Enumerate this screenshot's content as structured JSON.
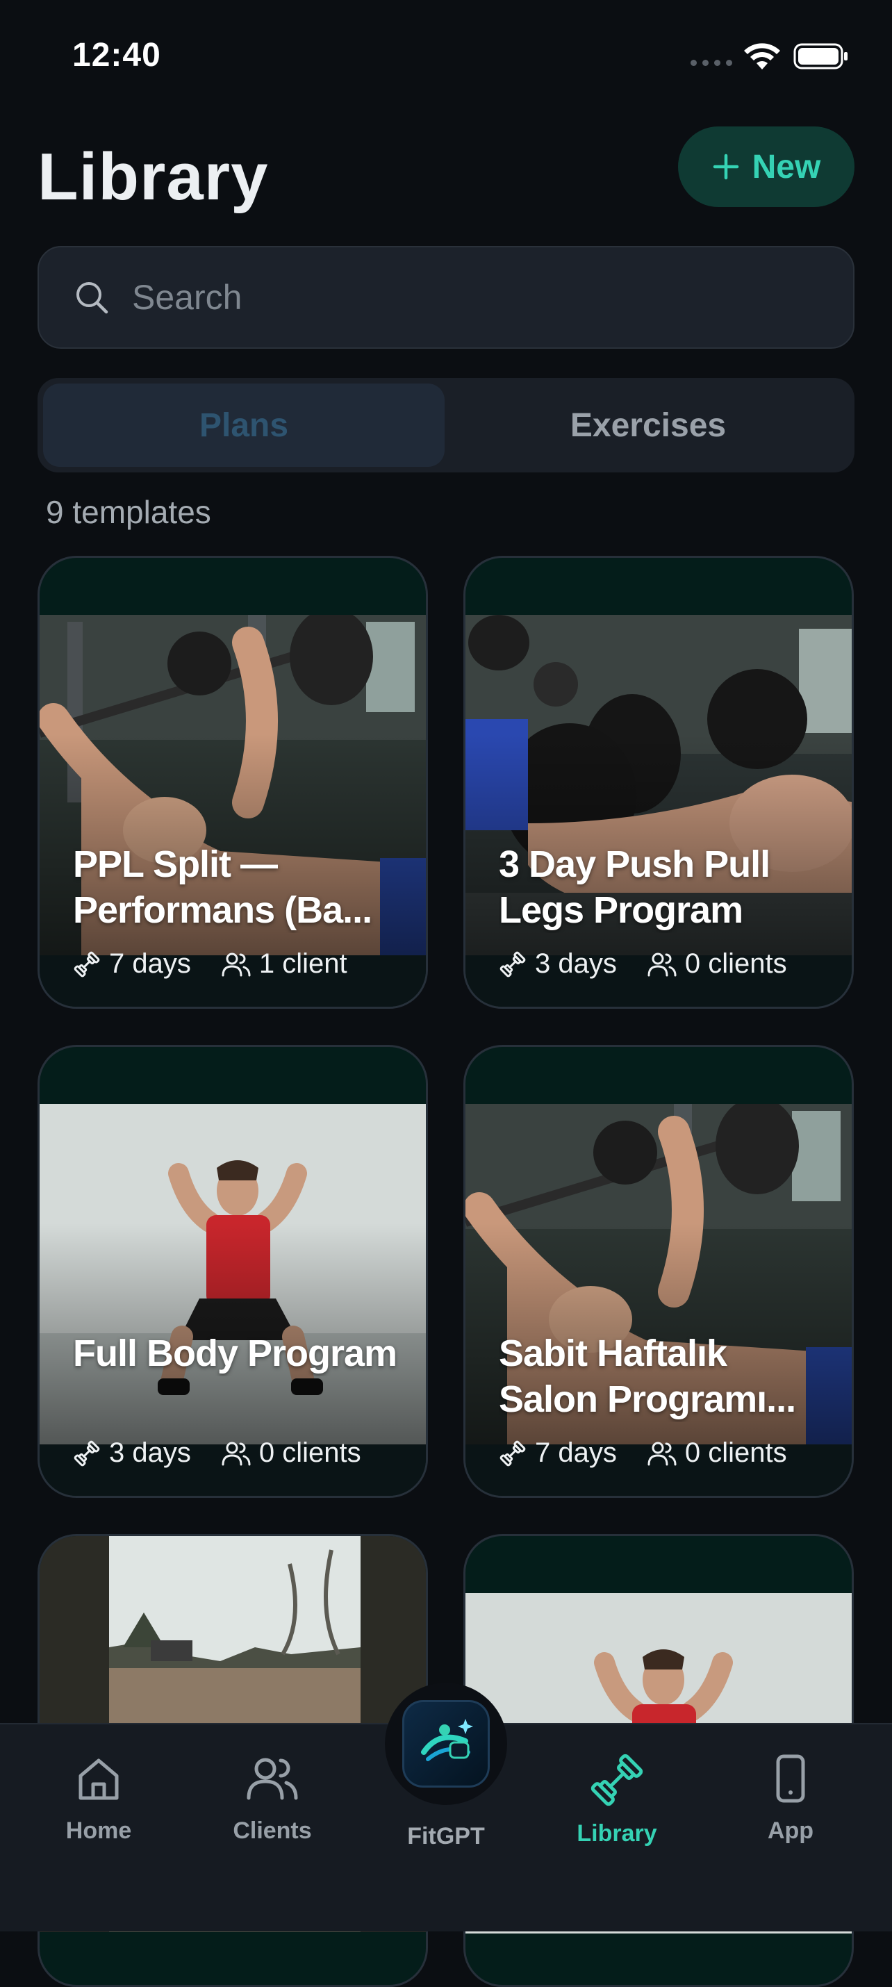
{
  "status_bar": {
    "time": "12:40"
  },
  "header": {
    "title": "Library",
    "new_button_label": "New"
  },
  "search": {
    "placeholder": "Search",
    "value": ""
  },
  "tabs": [
    {
      "label": "Plans",
      "active": true
    },
    {
      "label": "Exercises",
      "active": false
    }
  ],
  "template_count": "9 templates",
  "cards": [
    {
      "title": "PPL Split — Performans (Ba...",
      "days": "7 days",
      "clients": "1 client",
      "image": "bench-press-photo"
    },
    {
      "title": "3 Day Push Pull Legs Program",
      "days": "3 days",
      "clients": "0 clients",
      "image": "dumbbell-press-photo"
    },
    {
      "title": "Full Body Program",
      "days": "3 days",
      "clients": "0 clients",
      "image": "squat-photo"
    },
    {
      "title": "Sabit Haftalık Salon Programı...",
      "days": "7 days",
      "clients": "0 clients",
      "image": "bench-press-photo"
    },
    {
      "title": "",
      "days": "",
      "clients": "",
      "image": "outdoor-photo"
    },
    {
      "title": "",
      "days": "",
      "clients": "",
      "image": "squat-photo"
    }
  ],
  "nav": {
    "home": "Home",
    "clients": "Clients",
    "center": "FitGPT",
    "library": "Library",
    "app": "App",
    "active": "Library"
  },
  "colors": {
    "accent": "#35d2b4",
    "background": "#0b0e12",
    "card_bg": "#041d1a"
  }
}
